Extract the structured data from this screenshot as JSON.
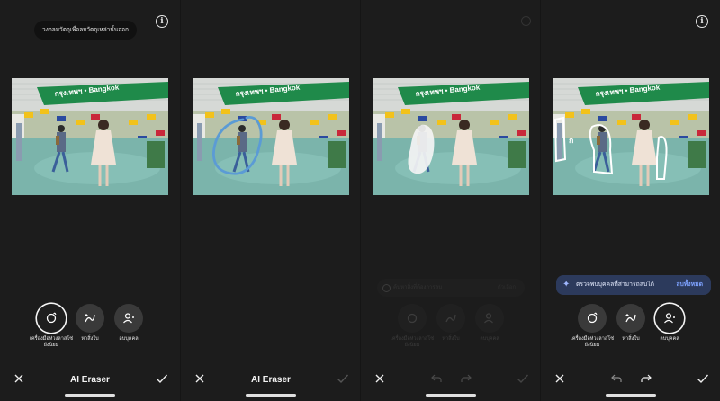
{
  "panel1": {
    "tooltip": "วงกลมวัตถุเพื่อลบวัตถุเหล่านั้นออก",
    "title": "AI Eraser",
    "tools": [
      {
        "label": "เครื่องมือห่วงลาสโซ่ยังนิยม",
        "icon": "lasso-icon",
        "active": true
      },
      {
        "label": "หาสิ่งใบ",
        "icon": "brush-icon",
        "active": false
      },
      {
        "label": "ลบบุคคล",
        "icon": "person-remove-icon",
        "active": false
      }
    ]
  },
  "panel2": {
    "title": "AI Eraser"
  },
  "panel3": {
    "search_hint": "ค้นหาสิ่งที่ต้องการลบ",
    "search_hint_right": "ตัวเลือก",
    "tools": [
      {
        "label": "เครื่องมือห่วงลาสโซ่ยังนิยม"
      },
      {
        "label": "หาสิ่งใบ"
      },
      {
        "label": "ลบบุคคล"
      }
    ]
  },
  "panel4": {
    "detect_text": "ตรวจพบบุคคลที่สามารถลบได้",
    "remove_all": "ลบทั้งหมด",
    "tools": [
      {
        "label": "เครื่องมือห่วงลาสโซ่ยังนิยม",
        "icon": "lasso-icon",
        "active": false
      },
      {
        "label": "หาสิ่งใบ",
        "icon": "brush-icon",
        "active": false
      },
      {
        "label": "ลบบุคคล",
        "icon": "person-remove-icon",
        "active": true
      }
    ]
  },
  "photo": {
    "sign_text": "กรุงเทพฯ • Bangkok"
  },
  "colors": {
    "background": "#1c1c1c",
    "tool_button": "#3a3a3a",
    "lasso_stroke": "#5b9bd5",
    "detect_bar": "#2c3a5c",
    "accent_link": "#7ea2ff"
  }
}
